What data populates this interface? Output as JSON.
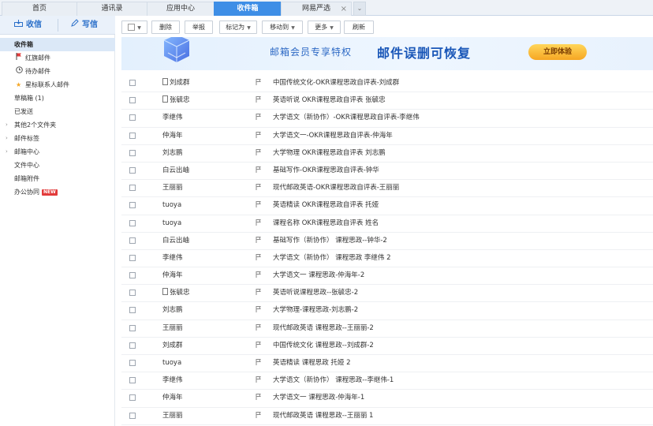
{
  "tabs": [
    {
      "label": "首页"
    },
    {
      "label": "通讯录"
    },
    {
      "label": "应用中心"
    },
    {
      "label": "收件箱"
    },
    {
      "label": "网易严选"
    }
  ],
  "compose": {
    "receive_label": "收信",
    "write_label": "写信"
  },
  "nav": {
    "items": [
      {
        "label": "收件箱"
      },
      {
        "label": "红旗邮件"
      },
      {
        "label": "待办邮件"
      },
      {
        "label": "星标联系人邮件"
      },
      {
        "label": "草稿箱 (1)"
      },
      {
        "label": "已发送"
      },
      {
        "label": "其他2个文件夹"
      },
      {
        "label": "邮件标签"
      },
      {
        "label": "邮箱中心"
      },
      {
        "label": "文件中心"
      },
      {
        "label": "邮箱附件"
      },
      {
        "label": "办公协同"
      }
    ],
    "new_badge": "NEW"
  },
  "toolbar": {
    "delete": "删除",
    "report": "举报",
    "mark_as": "标记为",
    "move_to": "移动到",
    "more": "更多",
    "refresh": "刷新"
  },
  "banner": {
    "text1": "邮箱会员专享特权",
    "text2": "邮件误删可恢复",
    "cta": "立即体验"
  },
  "emails": [
    {
      "sender": "刘成群",
      "has_doc": true,
      "subject": "中国传统文化-OKR课程思政自评表-刘成群"
    },
    {
      "sender": "张毓忠",
      "has_doc": true,
      "subject": "英语听说 OKR课程思政自评表 张毓忠"
    },
    {
      "sender": "李继伟",
      "has_doc": false,
      "subject": "大学语文（新协作）-OKR课程思政自评表-李继伟"
    },
    {
      "sender": "仲海年",
      "has_doc": false,
      "subject": "大学语文一-OKR课程思政自评表-仲海年"
    },
    {
      "sender": "刘志鹏",
      "has_doc": false,
      "subject": "大学物理 OKR课程思政自评表 刘志鹏"
    },
    {
      "sender": "白云出岫",
      "has_doc": false,
      "subject": "基础写作-OKR课程思政自评表-钟华"
    },
    {
      "sender": "王丽丽",
      "has_doc": false,
      "subject": "现代邮政英语-OKR课程思政自评表-王丽丽"
    },
    {
      "sender": "tuoya",
      "has_doc": false,
      "subject": "英语精读 OKR课程思政自评表 托娅"
    },
    {
      "sender": "tuoya",
      "has_doc": false,
      "subject": "课程名称 OKR课程思政自评表 姓名"
    },
    {
      "sender": "白云出岫",
      "has_doc": false,
      "subject": "基础写作（新协作） 课程思政--钟华-2"
    },
    {
      "sender": "李继伟",
      "has_doc": false,
      "subject": "大学语文（新协作） 课程思政 李继伟 2"
    },
    {
      "sender": "仲海年",
      "has_doc": false,
      "subject": "大学语文一 课程思政-仲海年-2"
    },
    {
      "sender": "张毓忠",
      "has_doc": true,
      "subject": "英语听说课程思政--张毓忠-2"
    },
    {
      "sender": "刘志鹏",
      "has_doc": false,
      "subject": "大学物理-课程思政-刘志鹏-2"
    },
    {
      "sender": "王丽丽",
      "has_doc": false,
      "subject": "现代邮政英语 课程思政--王丽丽-2"
    },
    {
      "sender": "刘成群",
      "has_doc": false,
      "subject": "中国传统文化 课程思政--刘成群-2"
    },
    {
      "sender": "tuoya",
      "has_doc": false,
      "subject": "英语精读 课程思政 托娅 2"
    },
    {
      "sender": "李继伟",
      "has_doc": false,
      "subject": "大学语文（新协作） 课程思政--李继伟-1"
    },
    {
      "sender": "仲海年",
      "has_doc": false,
      "subject": "大学语文一 课程思政-仲海年-1"
    },
    {
      "sender": "王丽丽",
      "has_doc": false,
      "subject": "现代邮政英语 课程思政--王丽丽 1"
    }
  ],
  "colors": {
    "accent": "#3e8ee6",
    "banner_title": "#1a57b8",
    "cta": "#f6a623",
    "flag": "#e23b3b",
    "star": "#f5a623"
  }
}
